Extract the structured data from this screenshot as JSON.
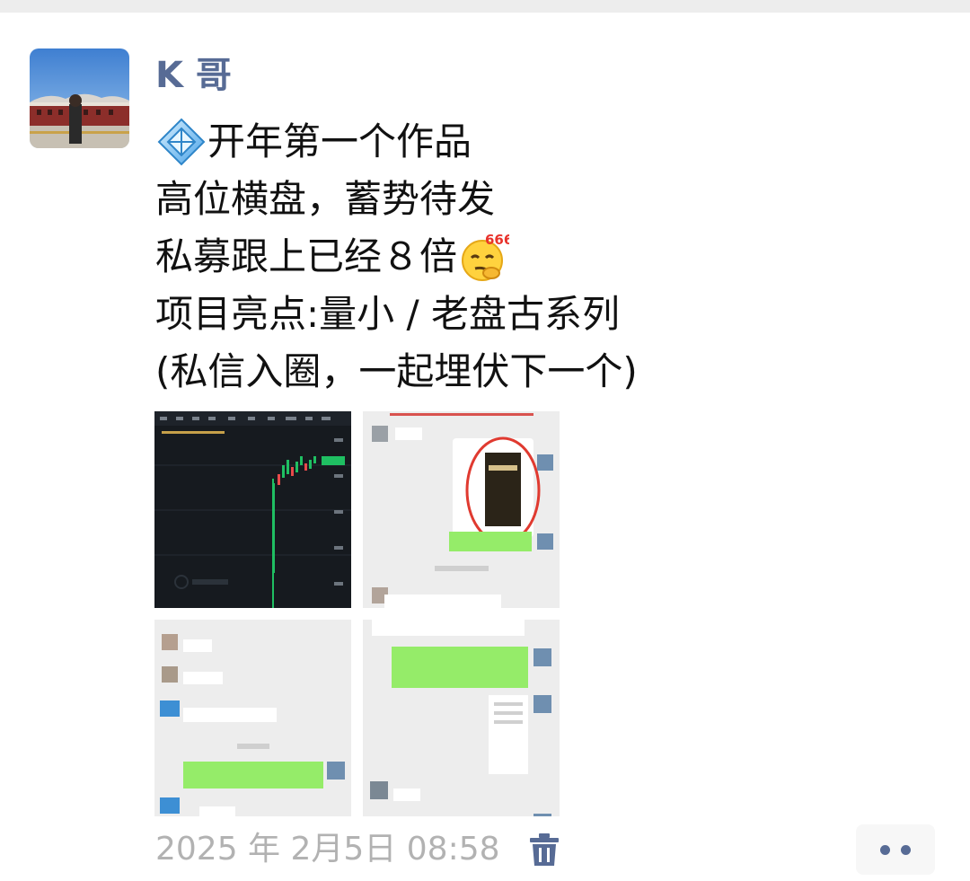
{
  "post": {
    "author": "K 哥",
    "avatar_icon": "user-photo-avatar",
    "lines": [
      {
        "prefix_icon": "diamond-emoji-icon",
        "text": "开年第一个作品"
      },
      {
        "text": "高位横盘，蓄势待发"
      },
      {
        "text": "私募跟上已经８倍",
        "suffix_icon": "thinking-666-emoji-icon",
        "emoji_label": "666"
      },
      {
        "text": "项目亮点:量小 / 老盘古系列"
      },
      {
        "text": "(私信入圈，一起埋伏下一个)"
      }
    ],
    "images": [
      {
        "icon": "candlestick-chart-screenshot",
        "caption": "trading chart"
      },
      {
        "icon": "chat-screenshot"
      },
      {
        "icon": "chat-screenshot"
      },
      {
        "icon": "chat-screenshot"
      }
    ],
    "timestamp": "2025 年 2月5日 08:58",
    "delete_icon": "trash-icon",
    "more_icon": "more-dots-icon"
  },
  "colors": {
    "name": "#576b95",
    "text": "#111111",
    "meta": "#b2b2b2",
    "chat_green": "#95ec69",
    "chart_up": "#1fbf62",
    "chart_down": "#e84a4a"
  }
}
